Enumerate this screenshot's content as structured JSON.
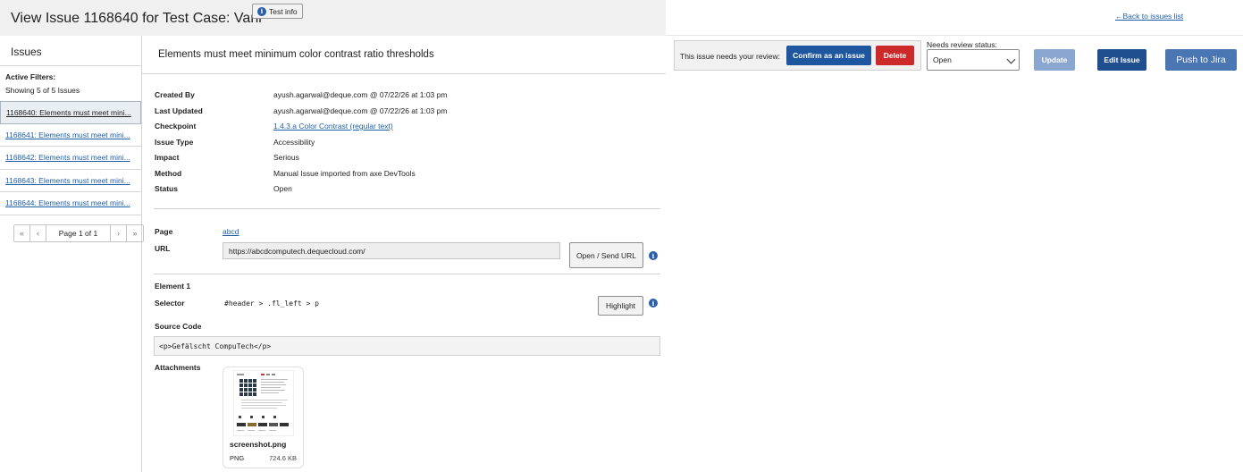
{
  "header": {
    "title": "View Issue 1168640 for Test Case: Vani",
    "test_info_label": "Test info",
    "back_link": "←Back to issues list"
  },
  "sidebar": {
    "title": "Issues",
    "active_filters": "Active Filters:",
    "showing": "Showing 5 of 5 Issues",
    "items": [
      {
        "label": "1168640: Elements must meet mini...",
        "active": true
      },
      {
        "label": "1168641: Elements must meet mini...",
        "active": false
      },
      {
        "label": "1168642: Elements must meet mini...",
        "active": false
      },
      {
        "label": "1168643: Elements must meet mini...",
        "active": false
      },
      {
        "label": "1168644: Elements must meet mini...",
        "active": false
      }
    ],
    "pager": {
      "first": "«",
      "prev": "‹",
      "label": "Page 1 of 1",
      "next": "›",
      "last": "»"
    }
  },
  "issue": {
    "title": "Elements must meet minimum color contrast ratio thresholds",
    "fields": [
      {
        "label": "Created By",
        "value": "ayush.agarwal@deque.com @ 07/22/26 at 1:03 pm",
        "link": false
      },
      {
        "label": "Last Updated",
        "value": "ayush.agarwal@deque.com @ 07/22/26 at 1:03 pm",
        "link": false
      },
      {
        "label": "Checkpoint",
        "value": "1.4.3.a Color Contrast (regular text)",
        "link": true
      },
      {
        "label": "Issue Type",
        "value": "Accessibility",
        "link": false
      },
      {
        "label": "Impact",
        "value": "Serious",
        "link": false
      },
      {
        "label": "Method",
        "value": "Manual Issue imported from axe DevTools",
        "link": false
      },
      {
        "label": "Status",
        "value": "Open",
        "link": false
      }
    ],
    "page_label": "Page",
    "page_value": "abcd",
    "url_label": "URL",
    "url_value": "https://abcdcomputech.dequecloud.com/",
    "open_url_button": "Open / Send URL",
    "element_heading": "Element 1",
    "selector_label": "Selector",
    "selector_value": "#header > .fl_left > p",
    "highlight_button": "Highlight",
    "source_label": "Source Code",
    "source_value": "<p>Gefälscht CompuTech</p>",
    "attachments_label": "Attachments",
    "attachment": {
      "name": "screenshot.png",
      "type": "PNG",
      "size": "724.6 KB"
    }
  },
  "review": {
    "prompt": "This issue needs your review:",
    "confirm_button": "Confirm as an issue",
    "delete_button": "Delete",
    "status_label": "Needs review status:",
    "status_value": "Open",
    "update_button": "Update",
    "edit_button": "Edit Issue",
    "jira_button": "Push to Jira"
  },
  "colors": {
    "primary_blue": "#1f56a0",
    "delete_red": "#cc2a2a",
    "disabled_blue": "#8aa7d1",
    "jira_blue": "#4a76b3",
    "link_blue": "#1f5fa8"
  }
}
